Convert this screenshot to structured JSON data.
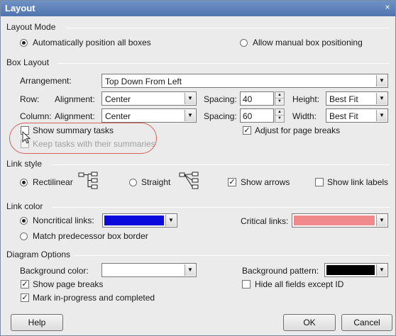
{
  "window": {
    "title": "Layout",
    "close_glyph": "×"
  },
  "layout_mode": {
    "label": "Layout Mode",
    "auto_label": "Automatically position all boxes",
    "manual_label": "Allow manual box positioning"
  },
  "box_layout": {
    "label": "Box Layout",
    "arrangement_label": "Arrangement:",
    "arrangement_value": "Top Down From Left",
    "row_label": "Row:",
    "column_label": "Column:",
    "alignment_label": "Alignment:",
    "row_alignment": "Center",
    "column_alignment": "Center",
    "spacing_label": "Spacing:",
    "row_spacing": "40",
    "column_spacing": "60",
    "height_label": "Height:",
    "height_value": "Best Fit",
    "width_label": "Width:",
    "width_value": "Best Fit",
    "show_summary_label": "Show summary tasks",
    "keep_tasks_label": "Keep tasks with their summaries",
    "adjust_breaks_label": "Adjust for page breaks"
  },
  "link_style": {
    "label": "Link style",
    "rectilinear_label": "Rectilinear",
    "straight_label": "Straight",
    "show_arrows_label": "Show arrows",
    "show_link_labels_label": "Show link labels"
  },
  "link_color": {
    "label": "Link color",
    "noncritical_label": "Noncritical links:",
    "noncritical_color": "#0a0adc",
    "critical_label": "Critical links:",
    "critical_color": "#f08a8a",
    "match_label": "Match predecessor box border"
  },
  "diagram_options": {
    "label": "Diagram Options",
    "bg_color_label": "Background color:",
    "bg_color": "#ffffff",
    "bg_pattern_label": "Background pattern:",
    "bg_pattern_color": "#000000",
    "show_page_breaks_label": "Show page breaks",
    "hide_fields_label": "Hide all fields except ID",
    "mark_progress_label": "Mark in-progress and completed"
  },
  "buttons": {
    "help": "Help",
    "ok": "OK",
    "cancel": "Cancel"
  },
  "glyphs": {
    "check": "✓",
    "down": "▼",
    "up": "▲"
  }
}
